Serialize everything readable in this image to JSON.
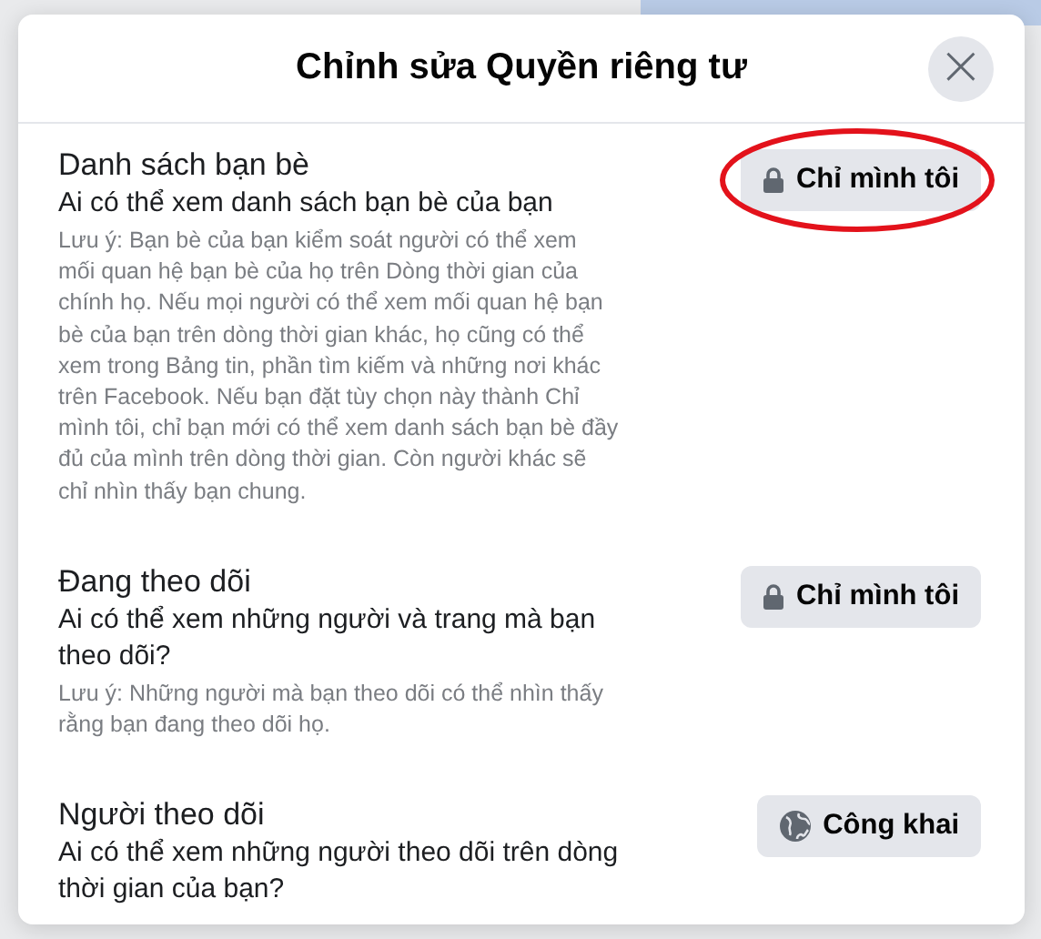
{
  "dialog": {
    "title": "Chỉnh sửa Quyền riêng tư",
    "close": "×",
    "sections": [
      {
        "title": "Danh sách bạn bè",
        "question": "Ai có thể xem danh sách bạn bè của bạn",
        "note": "Lưu ý: Bạn bè của bạn kiểm soát người có thể xem mối quan hệ bạn bè của họ trên Dòng thời gian của chính họ. Nếu mọi người có thể xem mối quan hệ bạn bè của bạn trên dòng thời gian khác, họ cũng có thể xem trong Bảng tin, phần tìm kiếm và những nơi khác trên Facebook. Nếu bạn đặt tùy chọn này thành Chỉ mình tôi, chỉ bạn mới có thể xem danh sách bạn bè đầy đủ của mình trên dòng thời gian. Còn người khác sẽ chỉ nhìn thấy bạn chung.",
        "audience": {
          "kind": "lock",
          "label": "Chỉ mình tôi"
        },
        "circled": true
      },
      {
        "title": "Đang theo dõi",
        "question": "Ai có thể xem những người và trang mà bạn theo dõi?",
        "note": "Lưu ý: Những người mà bạn theo dõi có thể nhìn thấy rằng bạn đang theo dõi họ.",
        "audience": {
          "kind": "lock",
          "label": "Chỉ mình tôi"
        },
        "circled": false
      },
      {
        "title": "Người theo dõi",
        "question": "Ai có thể xem những người theo dõi trên dòng thời gian của bạn?",
        "audience": {
          "kind": "globe",
          "label": "Công khai"
        },
        "circled": false
      }
    ]
  }
}
